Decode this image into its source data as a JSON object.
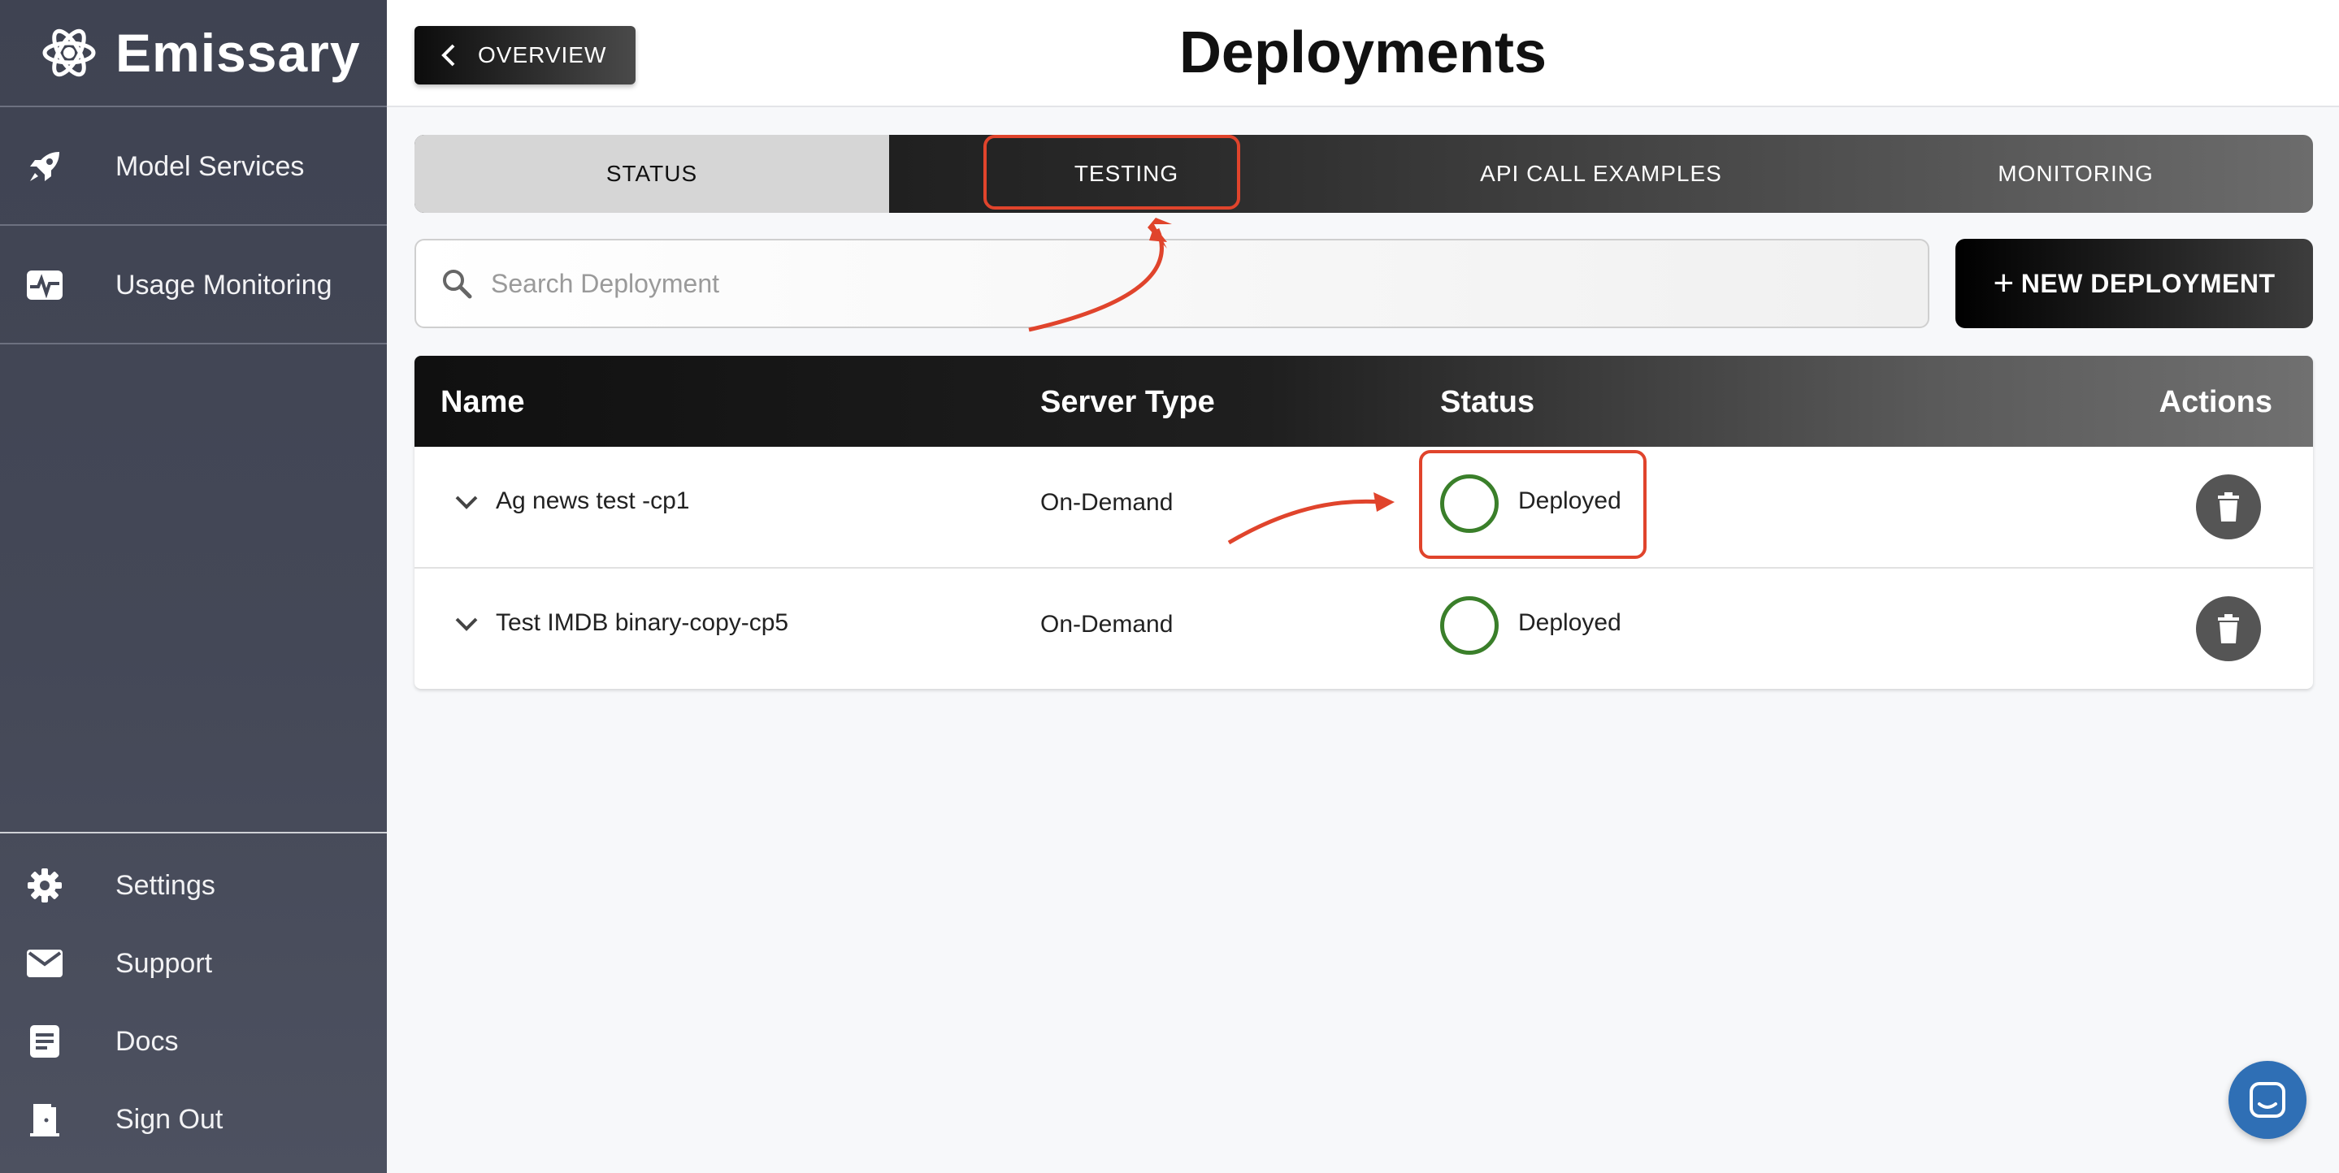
{
  "brand": {
    "name": "Emissary"
  },
  "sidebar": {
    "top_items": [
      {
        "label": "Model Services",
        "icon": "rocket-icon"
      },
      {
        "label": "Usage Monitoring",
        "icon": "pulse-icon"
      }
    ],
    "bottom_items": [
      {
        "label": "Settings",
        "icon": "gear-icon"
      },
      {
        "label": "Support",
        "icon": "mail-icon"
      },
      {
        "label": "Docs",
        "icon": "document-icon"
      },
      {
        "label": "Sign Out",
        "icon": "door-icon"
      }
    ]
  },
  "header": {
    "back_label": "OVERVIEW",
    "title": "Deployments"
  },
  "tabs": [
    {
      "label": "STATUS",
      "active": true
    },
    {
      "label": "TESTING",
      "active": false,
      "highlighted": true
    },
    {
      "label": "API CALL EXAMPLES",
      "active": false
    },
    {
      "label": "MONITORING",
      "active": false
    }
  ],
  "search": {
    "placeholder": "Search Deployment",
    "value": ""
  },
  "new_button": {
    "plus": "+",
    "label": "NEW DEPLOYMENT"
  },
  "table": {
    "columns": [
      "Name",
      "Server Type",
      "Status",
      "Actions"
    ],
    "rows": [
      {
        "name": "Ag news test -cp1",
        "server_type": "On-Demand",
        "status": "Deployed"
      },
      {
        "name": "Test IMDB binary-copy-cp5",
        "server_type": "On-Demand",
        "status": "Deployed"
      }
    ]
  },
  "colors": {
    "accent_annotation": "#e0442c",
    "status_ok": "#3a7f2a",
    "chat": "#2f6fb5",
    "sidebar": "#444857"
  }
}
